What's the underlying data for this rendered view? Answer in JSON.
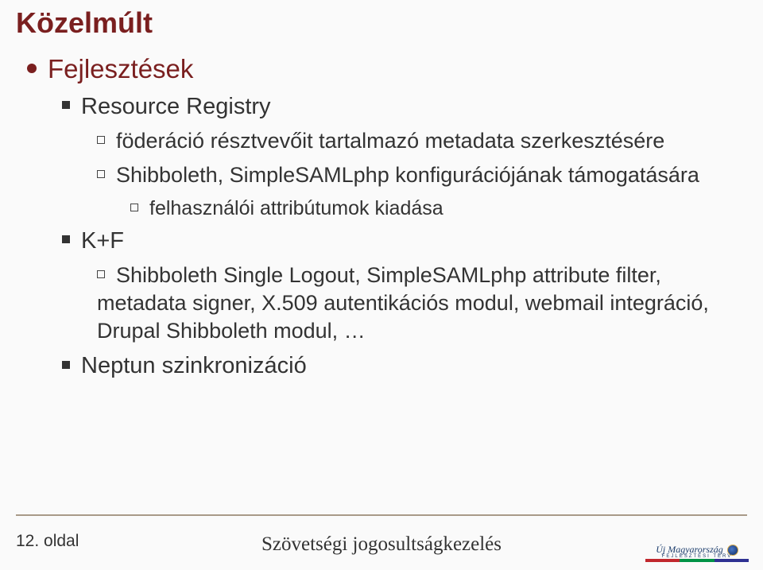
{
  "title": "Közelmúlt",
  "lvl1_1": "Fejlesztések",
  "lvl2_1": "Resource Registry",
  "lvl3_1": "föderáció résztvevőit tartalmazó metadata szerkesztésére",
  "lvl3_2": "Shibboleth, SimpleSAMLphp konfigurációjának támogatására",
  "lvl4_1": "felhasználói attribútumok kiadása",
  "lvl2_2": "K+F",
  "lvl3_3": "Shibboleth Single Logout, SimpleSAMLphp attribute filter, metadata signer, X.509 autentikációs modul, webmail integráció, Drupal Shibboleth modul, …",
  "lvl2_3": "Neptun szinkronizáció",
  "pagenum": "12. oldal",
  "foottitle": "Szövetségi jogosultságkezelés",
  "logo_top": "Új Magyarország",
  "logo_mid": "FEJLESZTÉSI TERV"
}
